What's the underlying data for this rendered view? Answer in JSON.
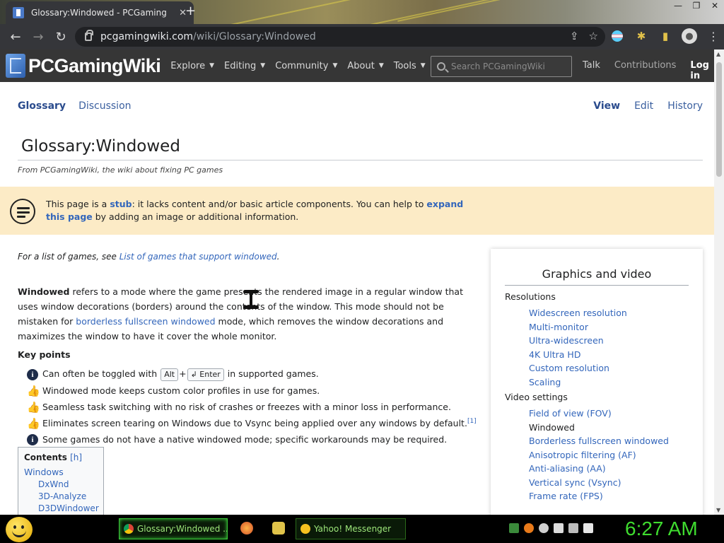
{
  "browser": {
    "tab_title": "Glossary:Windowed - PCGaming",
    "tab_close": "✕",
    "new_tab": "+",
    "window_controls": [
      "—",
      "❐",
      "✕"
    ],
    "url_host": "pcgamingwiki.com",
    "url_path": "/wiki/Glossary:Windowed",
    "nav": {
      "back": "←",
      "forward": "→",
      "reload": "↻"
    },
    "omnibox_icons": [
      "⇪",
      "☆"
    ],
    "extension_icons": [
      "flag-icon",
      "puzzle-icon",
      "sidebar-icon",
      "profile-icon",
      "menu-icon"
    ]
  },
  "site": {
    "logo": "PCGamingWiki",
    "nav": [
      {
        "label": "Explore"
      },
      {
        "label": "Editing"
      },
      {
        "label": "Community"
      },
      {
        "label": "About"
      },
      {
        "label": "Tools"
      }
    ],
    "search_placeholder": "Search PCGamingWiki",
    "user_links": {
      "talk": "Talk",
      "contributions": "Contributions",
      "login": "Log in"
    }
  },
  "page": {
    "tabs": {
      "glossary": "Glossary",
      "discussion": "Discussion"
    },
    "actions": {
      "view": "View",
      "edit": "Edit",
      "history": "History"
    },
    "title": "Glossary:Windowed",
    "tagline": "From PCGamingWiki, the wiki about fixing PC games",
    "stub": {
      "pre": "This page is a ",
      "stub_link": "stub",
      "mid": ": it lacks content and/or basic article components. You can help to ",
      "expand_link": "expand this page",
      "post": " by adding an image or additional information."
    },
    "seealso": {
      "pre": "For a list of games, see ",
      "link": "List of games that support windowed",
      "post": "."
    },
    "intro": {
      "bold": "Windowed",
      "text1": " refers to a mode where the game presents the rendered image in a regular window that uses window decorations (borders) around the contents of the window. This mode should not be mistaken for ",
      "link": "borderless fullscreen windowed",
      "text2": " mode, which removes the window decorations and maximizes the window to have it cover the whole monitor."
    },
    "key_points_heading": "Key points",
    "key_points": {
      "kp1_pre": "Can often be toggled with ",
      "kp1_key1": "Alt",
      "kp1_plus": "+",
      "kp1_key2": "↲ Enter",
      "kp1_post": " in supported games.",
      "kp2": "Windowed mode keeps custom color profiles in use for games.",
      "kp3": "Seamless task switching with no risk of crashes or freezes with a minor loss in performance.",
      "kp4": "Eliminates screen tearing on Windows due to Vsync being applied over any windows by default.",
      "kp4_ref": "[1]",
      "kp5": "Some games do not have a native windowed mode; specific workarounds may be required."
    },
    "toc": {
      "heading": "Contents",
      "toggle": "[h]",
      "items": [
        "Windows",
        "DxWnd",
        "3D-Analyze",
        "D3DWindower"
      ]
    },
    "infobox": {
      "title": "Graphics and video",
      "sections": [
        {
          "heading": "Resolutions",
          "items": [
            "Widescreen resolution",
            "Multi-monitor",
            "Ultra-widescreen",
            "4K Ultra HD",
            "Custom resolution",
            "Scaling"
          ]
        },
        {
          "heading": "Video settings",
          "items": [
            "Field of view (FOV)",
            "Windowed",
            "Borderless fullscreen windowed",
            "Anisotropic filtering (AF)",
            "Anti-aliasing (AA)",
            "Vertical sync (Vsync)",
            "Frame rate (FPS)"
          ]
        }
      ],
      "current_item": "Windowed"
    }
  },
  "taskbar": {
    "items": [
      {
        "label": "Glossary:Windowed ..."
      },
      {
        "label": "Yahoo! Messenger"
      }
    ],
    "clock": "6:27 AM",
    "accent": "#3fdc2f"
  }
}
